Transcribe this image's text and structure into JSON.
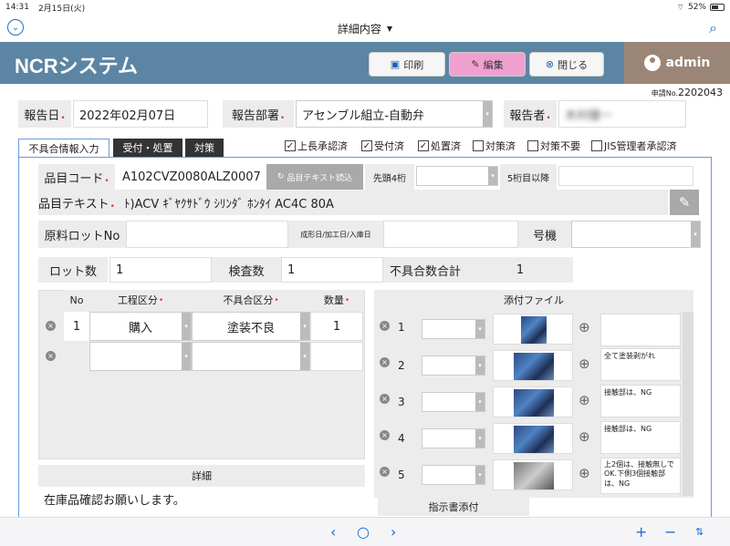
{
  "status": {
    "time": "14:31",
    "date": "2月15日(火)",
    "battery": "52%"
  },
  "topbar": {
    "title": "詳細内容",
    "caret": "▼"
  },
  "header": {
    "title": "NCRシステム",
    "print_label": "印刷",
    "edit_label": "編集",
    "close_label": "閉じる",
    "user": "admin"
  },
  "request": {
    "prefix": "申請No.",
    "number": "2202043"
  },
  "report": {
    "date_label": "報告日",
    "date_value": "2022年02月07日",
    "dept_label": "報告部署",
    "dept_value": "アセンブル組立-自動弁",
    "reporter_label": "報告者",
    "reporter_value": "木村健一"
  },
  "tabs": [
    "不具合情報入力",
    "受付・処置",
    "対策"
  ],
  "checks": [
    {
      "label": "上長承認済",
      "checked": true
    },
    {
      "label": "受付済",
      "checked": true
    },
    {
      "label": "処置済",
      "checked": true
    },
    {
      "label": "対策済",
      "checked": false
    },
    {
      "label": "対策不要",
      "checked": false
    },
    {
      "label": "JIS管理者承認済",
      "checked": false
    }
  ],
  "item": {
    "code_label": "品目コード",
    "code_value": "A102CVZ0080ALZ0007",
    "reload_label": "品目テキスト読込",
    "first4_label": "先頭4桁",
    "after5_label": "5桁目以降",
    "text_label": "品目テキスト",
    "text_value": "ﾄ)ACV ｷﾞﾔｸｻﾄﾞｳ ｼﾘﾝﾀﾞ ﾎﾝﾀｲ AC4C 80A"
  },
  "lot": {
    "material_label": "原料ロットNo",
    "date_label": "成形日/加工日/入庫日",
    "machine_label": "号機",
    "lot_count_label": "ロット数",
    "lot_count_value": "1",
    "inspect_label": "検査数",
    "inspect_value": "1",
    "defect_total_label": "不具合数合計",
    "defect_total_value": "1"
  },
  "defects": {
    "headers": [
      "No",
      "工程区分",
      "不具合区分",
      "数量"
    ],
    "rows": [
      {
        "no": "1",
        "process": "購入",
        "defect": "塗装不良",
        "qty": "1"
      }
    ]
  },
  "detail": {
    "label": "詳細",
    "text": "在庫品確認お願いします。"
  },
  "attachments": {
    "label": "添付ファイル",
    "rows": [
      {
        "no": "1",
        "note": ""
      },
      {
        "no": "2",
        "note": "全て塗装剥がれ"
      },
      {
        "no": "3",
        "note": "接触部は、NG"
      },
      {
        "no": "4",
        "note": "接触部は、NG"
      },
      {
        "no": "5",
        "note": "上2個は、接触無しでOK.下側3個接触部は、NG"
      }
    ],
    "instruction_label": "指示書添付"
  }
}
